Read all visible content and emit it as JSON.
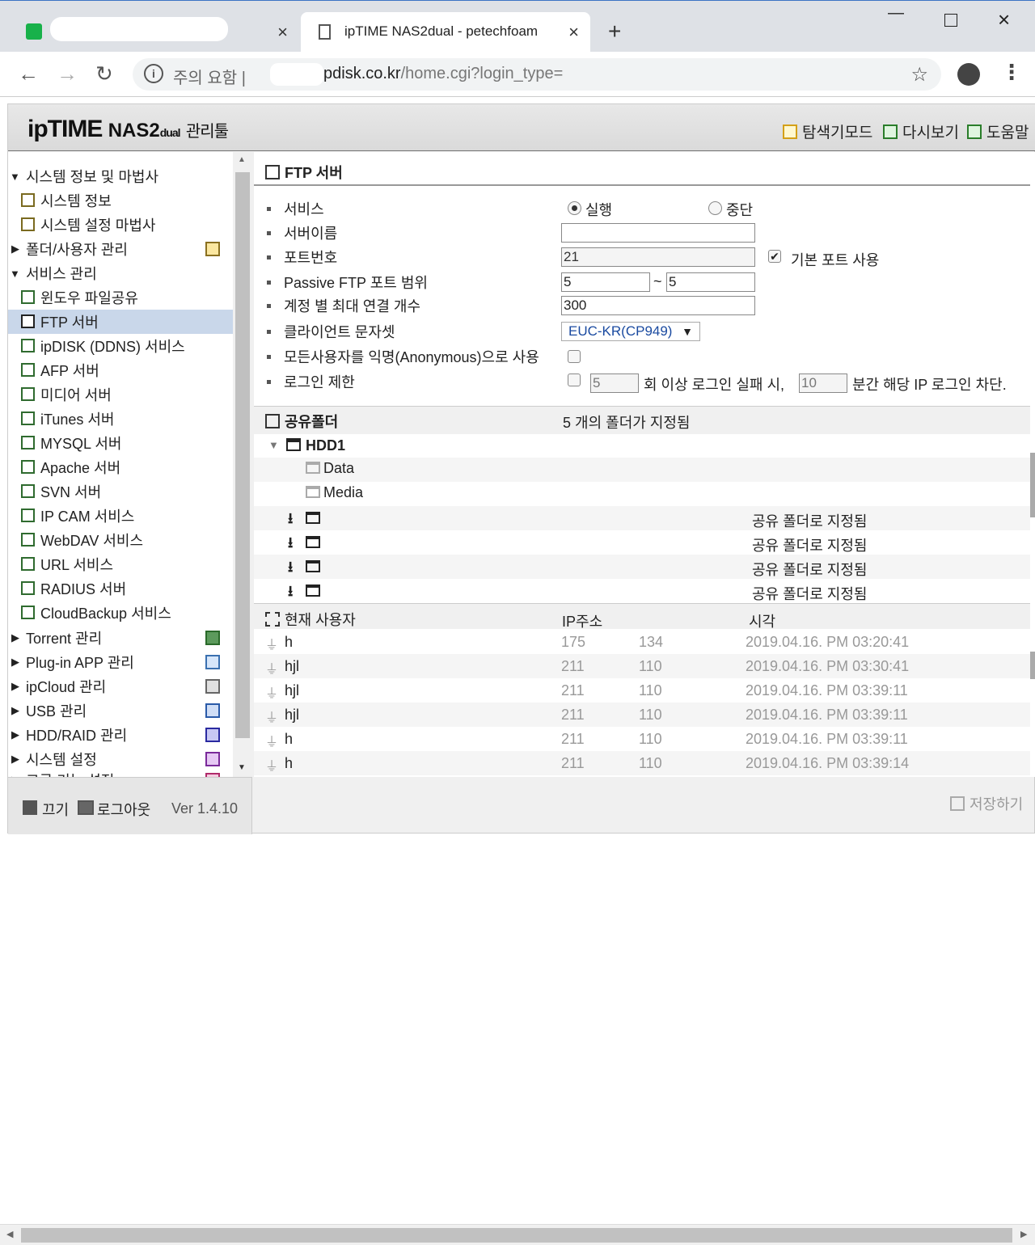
{
  "browser": {
    "tab_title": "ipTIME NAS2dual - petechfoam",
    "url_warning": "주의 요함",
    "url_host": "pdisk.co.kr",
    "url_path": "/home.cgi?login_type="
  },
  "app": {
    "logo_prefix": "ip",
    "logo_brand": "TIME",
    "logo_model": "NAS2",
    "logo_dual": "dual",
    "logo_tool": "관리툴",
    "header_links": [
      "탐색기모드",
      "다시보기",
      "도움말"
    ]
  },
  "sidebar": {
    "sys_group": "시스템 정보 및 마법사",
    "sys_info": "시스템 정보",
    "sys_wizard": "시스템 설정 마법사",
    "folder_user": "폴더/사용자 관리",
    "service_group": "서비스 관리",
    "services": [
      "윈도우 파일공유",
      "FTP 서버",
      "ipDISK (DDNS) 서비스",
      "AFP 서버",
      "미디어 서버",
      "iTunes 서버",
      "MYSQL 서버",
      "Apache 서버",
      "SVN 서버",
      "IP CAM 서비스",
      "WebDAV 서비스",
      "URL 서비스",
      "RADIUS 서버",
      "CloudBackup 서비스"
    ],
    "groups": [
      "Torrent 관리",
      "Plug-in APP 관리",
      "ipCloud 관리",
      "USB 관리",
      "HDD/RAID 관리",
      "시스템 설정",
      "고급 기능 설정"
    ],
    "footer_off": "끄기",
    "footer_logout": "로그아웃",
    "version": "Ver 1.4.10"
  },
  "ftp": {
    "title": "FTP 서버",
    "labels": {
      "service": "서비스",
      "server_name": "서버이름",
      "port": "포트번호",
      "passive": "Passive FTP 포트 범위",
      "max_conn": "계정 별 최대 연결 개수",
      "charset": "클라이언트 문자셋",
      "anonymous": "모든사용자를 익명(Anonymous)으로 사용",
      "login_limit": "로그인 제한"
    },
    "run": "실행",
    "stop": "중단",
    "port_value": "21",
    "default_port": "기본 포트 사용",
    "passive_from": "5",
    "passive_tilde": "~",
    "passive_to": "5",
    "max_conn_value": "300",
    "charset_value": "EUC-KR(CP949)",
    "fail_count": "5",
    "fail_text": "회 이상 로그인 실패 시,",
    "minutes": "10",
    "block_text": "분간 해당 IP 로그인 차단."
  },
  "shared": {
    "title": "공유폴더",
    "count_text": "5  개의 폴더가 지정됨",
    "disk": "HDD1",
    "folders": [
      "Data",
      "Media"
    ],
    "assigned": "공유 폴더로 지정됨"
  },
  "users": {
    "title": "현재 사용자",
    "col_ip": "IP주소",
    "col_time": "시각",
    "rows": [
      {
        "name": "h",
        "ip1": "175",
        "ip2": "134",
        "time": "2019.04.16. PM 03:20:41"
      },
      {
        "name": "hjl",
        "ip1": "211",
        "ip2": "110",
        "time": "2019.04.16. PM 03:30:41"
      },
      {
        "name": "hjl",
        "ip1": "211",
        "ip2": "110",
        "time": "2019.04.16. PM 03:39:11"
      },
      {
        "name": "hjl",
        "ip1": "211",
        "ip2": "110",
        "time": "2019.04.16. PM 03:39:11"
      },
      {
        "name": "h",
        "ip1": "211",
        "ip2": "110",
        "time": "2019.04.16. PM 03:39:11"
      },
      {
        "name": "h",
        "ip1": "211",
        "ip2": "110",
        "time": "2019.04.16. PM 03:39:14"
      }
    ]
  },
  "save_label": "저장하기"
}
